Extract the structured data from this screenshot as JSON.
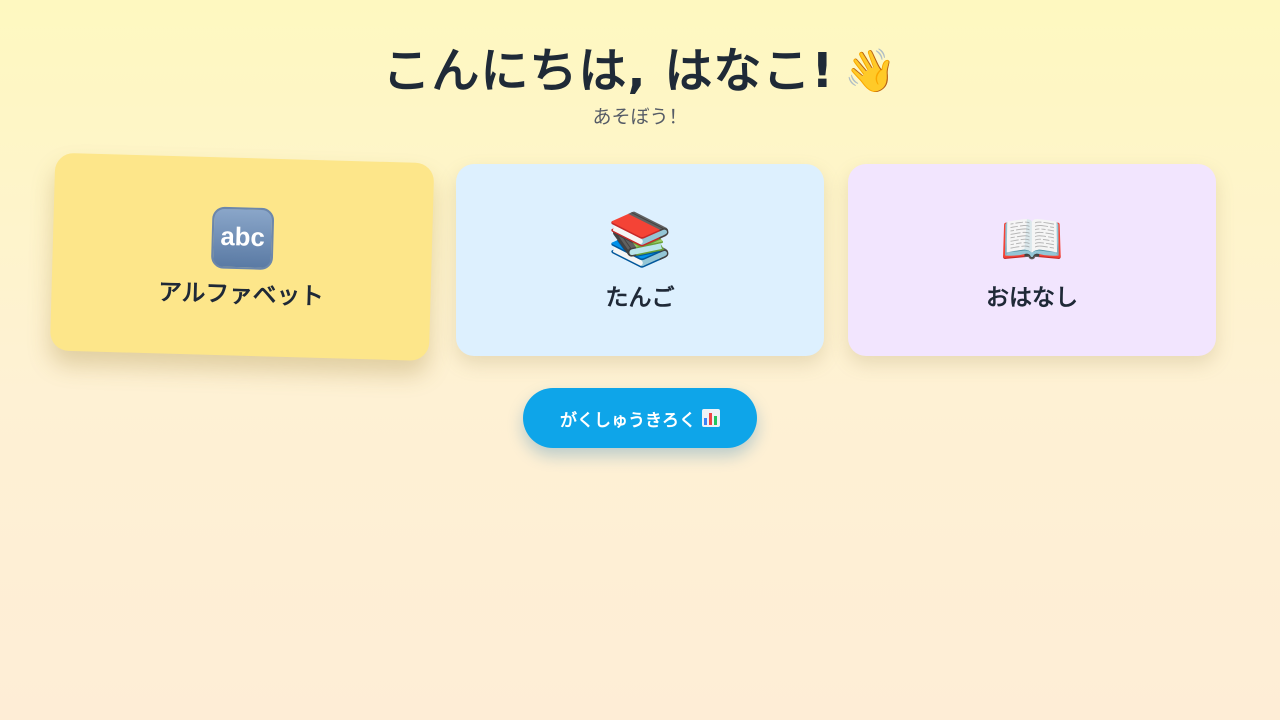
{
  "header": {
    "greeting": "こんにちは, はなこ!",
    "greeting_icon": "👋",
    "subtitle": "あそぼう！"
  },
  "cards": [
    {
      "label": "アルファベット",
      "icon_name": "abc-icon",
      "icon_text": "abc",
      "color": "#fde68a"
    },
    {
      "label": "たんご",
      "icon_name": "books-icon",
      "icon": "📚",
      "color": "#ddf0fe"
    },
    {
      "label": "おはなし",
      "icon_name": "open-book-icon",
      "icon": "📖",
      "color": "#f2e5fe"
    }
  ],
  "history_button": {
    "label": "がくしゅうきろく",
    "icon_name": "bar-chart-icon"
  },
  "colors": {
    "accent": "#0ea5e9",
    "text": "#1f2937"
  }
}
